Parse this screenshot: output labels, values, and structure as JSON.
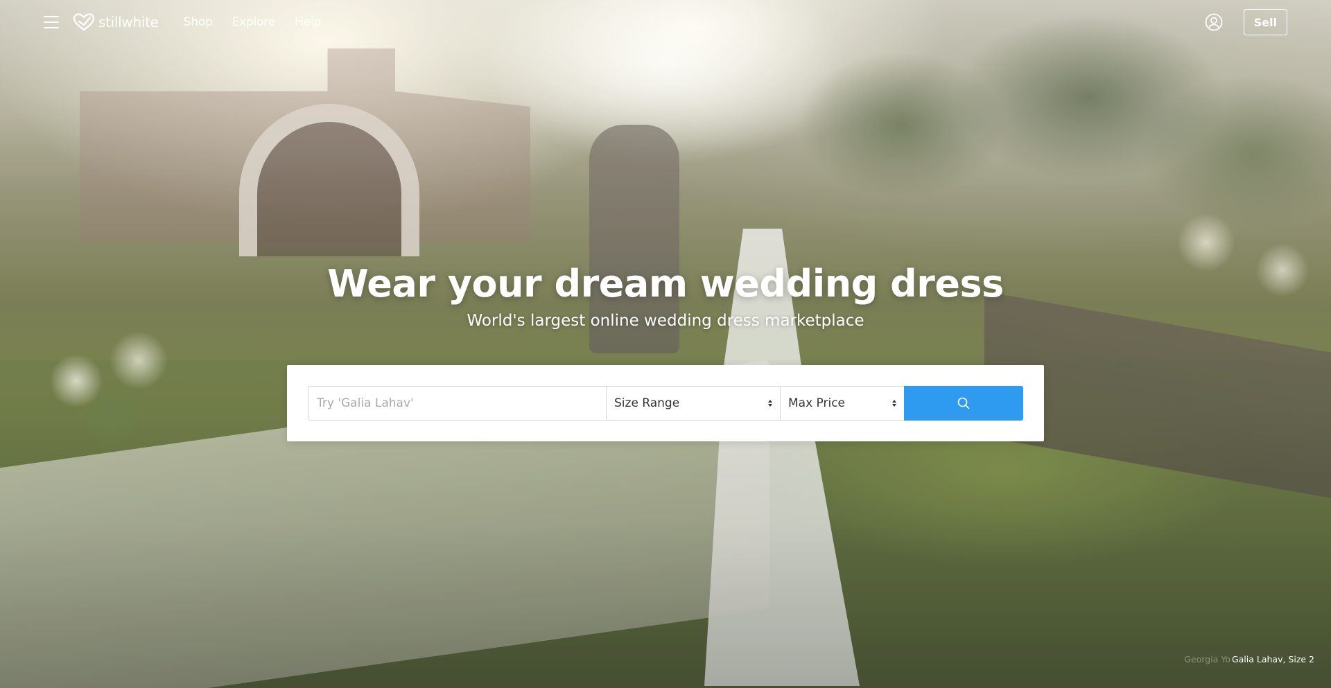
{
  "nav": {
    "logo_text": "stillwhite",
    "links": [
      "Shop",
      "Explore",
      "Help"
    ],
    "sell_label": "Sell"
  },
  "hero": {
    "headline": "Wear your dream wedding dress",
    "subheadline": "World's largest online wedding dress marketplace"
  },
  "search": {
    "placeholder": "Try 'Galia Lahav'",
    "size_select": "Size Range",
    "price_select": "Max Price"
  },
  "photo_credit": {
    "previous": "Georgia Yo",
    "current": "Galia Lahav, Size 2"
  },
  "colors": {
    "accent": "#2f9bf0",
    "nav_text": "#ffffff"
  },
  "icons": {
    "menu": "hamburger-icon",
    "logo": "heart-icon",
    "account": "user-circle-icon",
    "search": "magnifier-icon"
  }
}
